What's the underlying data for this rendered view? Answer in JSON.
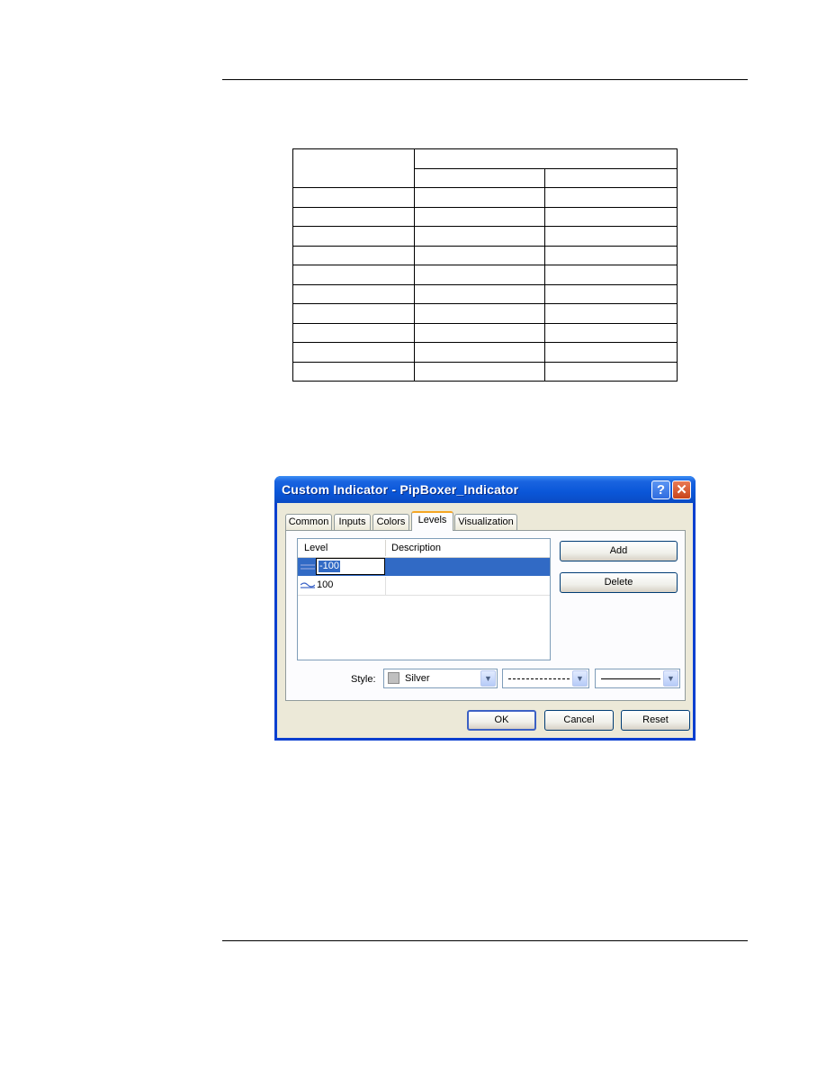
{
  "document": {
    "table": {
      "header_rows": 2,
      "body_rows": 10,
      "columns": 3,
      "cells": []
    }
  },
  "dialog": {
    "title": "Custom Indicator - PipBoxer_Indicator",
    "help_glyph": "?",
    "close_glyph": "✕",
    "tabs": [
      {
        "label": "Common",
        "active": false
      },
      {
        "label": "Inputs",
        "active": false
      },
      {
        "label": "Colors",
        "active": false
      },
      {
        "label": "Levels",
        "active": true
      },
      {
        "label": "Visualization",
        "active": false
      }
    ],
    "levels_list": {
      "columns": [
        "Level",
        "Description"
      ],
      "rows": [
        {
          "level": "-100",
          "description": "",
          "icon": "level-line-icon",
          "selected": true,
          "editing": true
        },
        {
          "level": "100",
          "description": "",
          "icon": "level-line-icon",
          "selected": false,
          "editing": false
        }
      ]
    },
    "buttons": {
      "add": "Add",
      "delete": "Delete",
      "ok": "OK",
      "cancel": "Cancel",
      "reset": "Reset"
    },
    "style": {
      "label": "Style:",
      "color_name": "Silver",
      "color_hex": "#c0c0c0",
      "line_style": "dashed",
      "line_width": "thin solid",
      "dropdown_glyph": "▼"
    }
  }
}
